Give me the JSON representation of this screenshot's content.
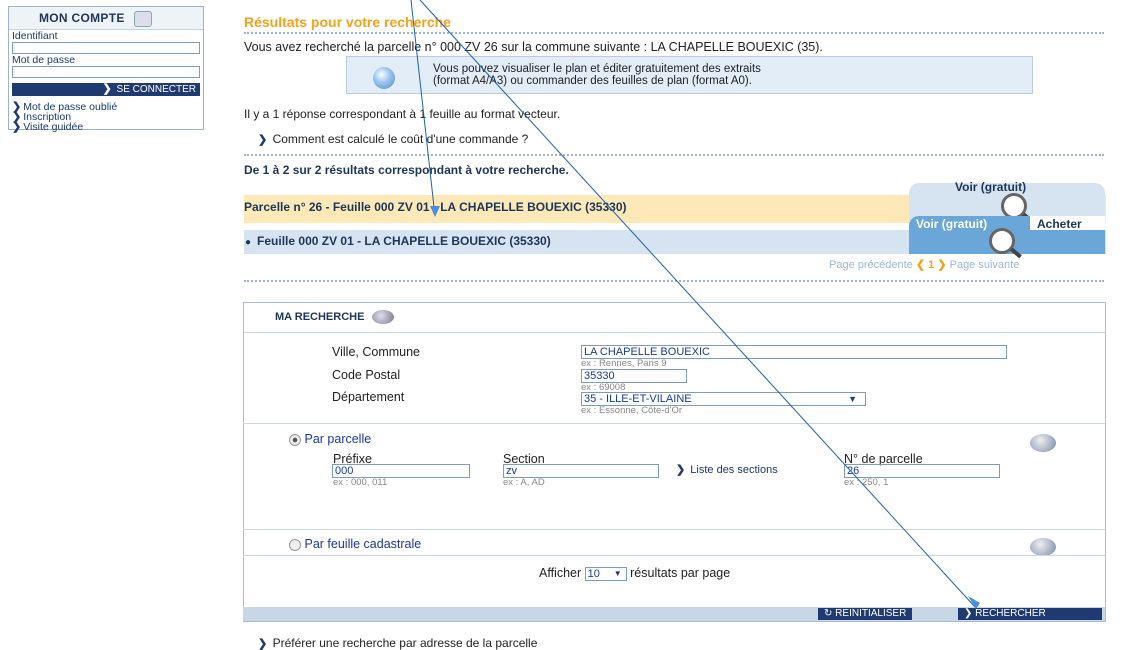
{
  "account": {
    "title": "MON COMPTE",
    "id_label": "Identifiant",
    "pwd_label": "Mot de passe",
    "login_button": "SE CONNECTER",
    "links": [
      "Mot de passe oublié",
      "Inscription",
      "Visite guidée"
    ]
  },
  "main": {
    "section_title": "Résultats pour votre recherche",
    "search_summary": "Vous avez recherché la parcelle n° 000 ZV 26 sur la commune suivante : LA CHAPELLE BOUEXIC (35).",
    "info_text_1": "Vous pouvez visualiser le plan et éditer gratuitement des extraits",
    "info_text_2": "(format A4/A3) ou commander des feuilles de plan (format A0).",
    "response_count": "Il y a 1 réponse correspondant à 1 feuille au format vecteur.",
    "cost_link": "Comment est calculé le coût d'une commande ?",
    "results_range": "De 1 à 2 sur 2 résultats correspondant à votre recherche.",
    "result_parcel": "Parcelle n° 26 - Feuille 000 ZV 01 - LA CHAPELLE BOUEXIC (35330)",
    "result_sheet": "Feuille 000 ZV 01 - LA CHAPELLE BOUEXIC (35330)",
    "view_free_1": "Voir (gratuit)",
    "view_free_2": "Voir (gratuit)",
    "buy": "Acheter",
    "pager_prev": "Page précédente",
    "pager_current": "1",
    "pager_next": "Page suivante"
  },
  "search": {
    "title": "MA RECHERCHE",
    "city_label": "Ville, Commune",
    "city_value": "LA CHAPELLE BOUEXIC",
    "city_example": "ex : Rennes, Paris 9",
    "postal_label": "Code Postal",
    "postal_value": "35330",
    "postal_example": "ex : 69008",
    "dept_label": "Département",
    "dept_value": "35 - ILLE-ET-VILAINE",
    "dept_example": "ex : Essonne, Côte-d'Or",
    "by_parcel": "Par parcelle",
    "prefix_label": "Préfixe",
    "prefix_value": "000",
    "prefix_example": "ex : 000, 011",
    "section_label": "Section",
    "section_value": "zv",
    "section_example": "ex : A, AD",
    "sections_link": "Liste des sections",
    "parcel_num_label": "N° de parcelle",
    "parcel_num_value": "26",
    "parcel_num_example": "ex : 250, 1",
    "by_sheet": "Par feuille cadastrale",
    "show_label": "Afficher",
    "per_page_value": "10",
    "per_page_suffix": "résultats par page",
    "reset_button": "REINITIALISER",
    "search_button": "RECHERCHER"
  },
  "footer_link": "Préférer une recherche par adresse de la parcelle"
}
